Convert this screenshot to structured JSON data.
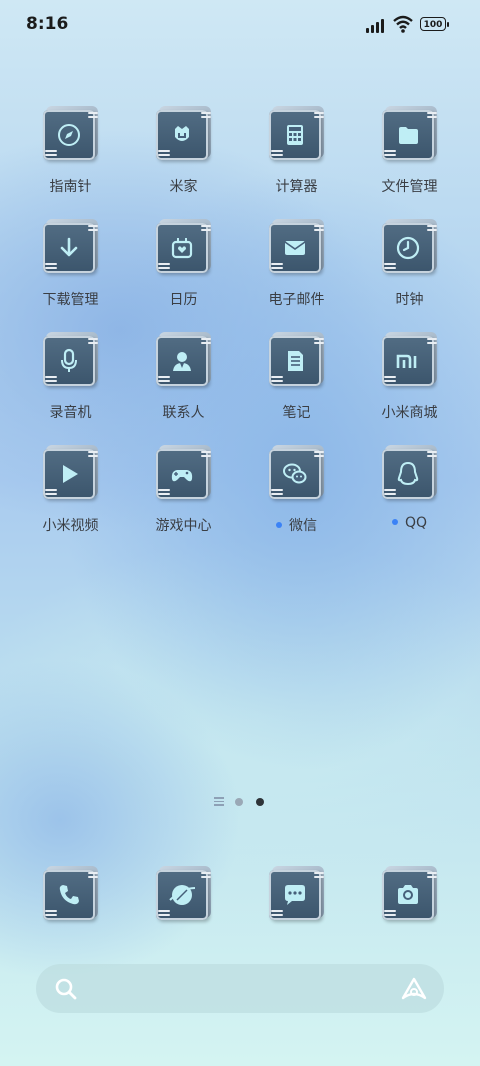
{
  "status": {
    "time": "8:16",
    "battery": "100"
  },
  "apps": [
    {
      "label": "指南针",
      "icon": "compass-icon",
      "dot": false
    },
    {
      "label": "米家",
      "icon": "mihome-icon",
      "dot": false
    },
    {
      "label": "计算器",
      "icon": "calculator-icon",
      "dot": false
    },
    {
      "label": "文件管理",
      "icon": "folder-icon",
      "dot": false
    },
    {
      "label": "下载管理",
      "icon": "download-icon",
      "dot": false
    },
    {
      "label": "日历",
      "icon": "calendar-icon",
      "dot": false
    },
    {
      "label": "电子邮件",
      "icon": "mail-icon",
      "dot": false
    },
    {
      "label": "时钟",
      "icon": "clock-icon",
      "dot": false
    },
    {
      "label": "录音机",
      "icon": "microphone-icon",
      "dot": false
    },
    {
      "label": "联系人",
      "icon": "contacts-icon",
      "dot": false
    },
    {
      "label": "笔记",
      "icon": "notes-icon",
      "dot": false
    },
    {
      "label": "小米商城",
      "icon": "mi-store-icon",
      "dot": false
    },
    {
      "label": "小米视频",
      "icon": "video-play-icon",
      "dot": false
    },
    {
      "label": "游戏中心",
      "icon": "gamepad-icon",
      "dot": false
    },
    {
      "label": "微信",
      "icon": "wechat-icon",
      "dot": true
    },
    {
      "label": "QQ",
      "icon": "qq-penguin-icon",
      "dot": true
    }
  ],
  "dock": [
    {
      "icon": "phone-icon"
    },
    {
      "icon": "browser-icon"
    },
    {
      "icon": "messages-icon"
    },
    {
      "icon": "camera-icon"
    }
  ],
  "pager": {
    "pages": 2,
    "current": 2
  },
  "colors": {
    "icon_face": "#46607a",
    "icon_glyph": "#bfeef5",
    "accent_dot": "#3b82f6"
  }
}
